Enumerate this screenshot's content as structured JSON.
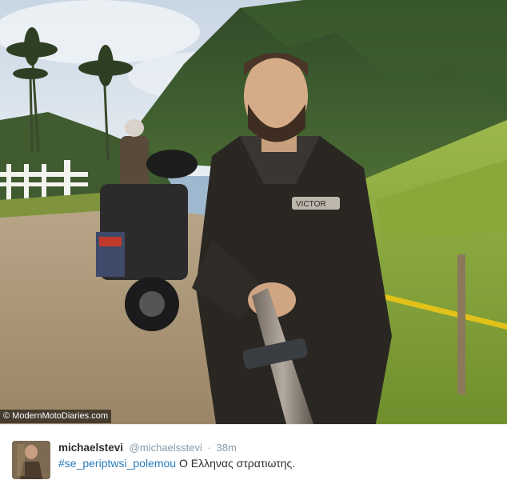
{
  "photo": {
    "credit": "© ModernMotoDiaries.com",
    "sticker_text": "VICTOR"
  },
  "tweet": {
    "display_name": "michaelstevi",
    "handle": "@michaelsstevi",
    "separator": "·",
    "time": "38m",
    "hashtag": "#se_periptwsi_polemou",
    "text": "Ο Ελληνας στρατιωτης.",
    "colors": {
      "link": "#2b7bb9",
      "name": "#292f33",
      "meta": "#8899a6"
    }
  }
}
